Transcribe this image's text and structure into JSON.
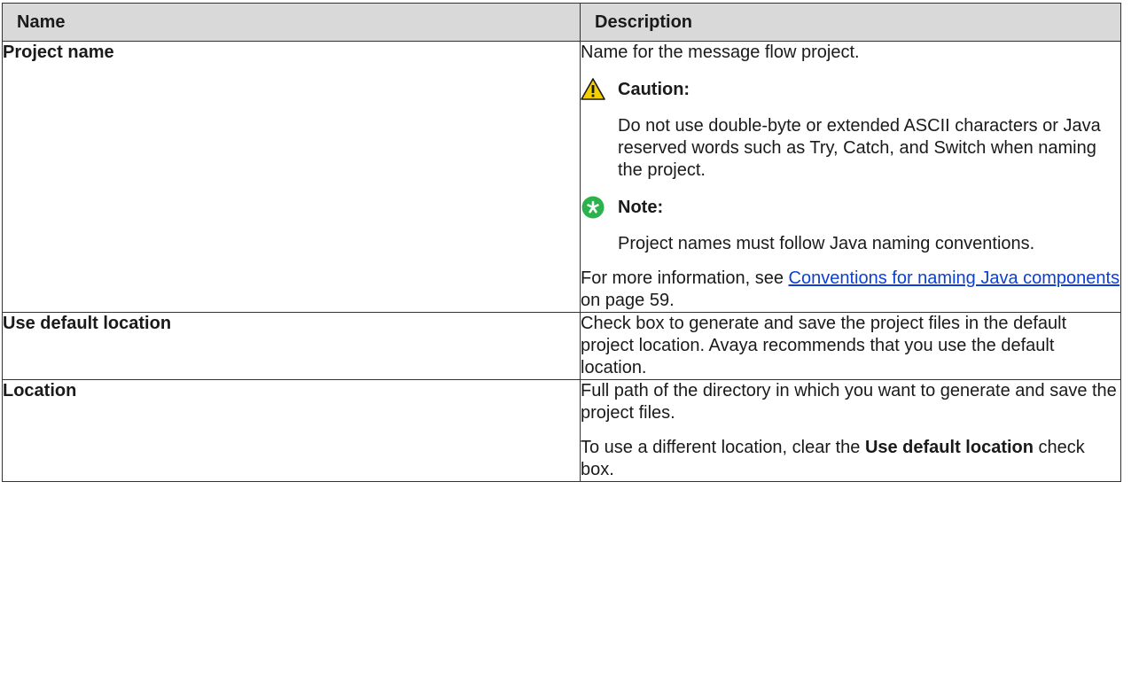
{
  "table": {
    "headers": {
      "name": "Name",
      "description": "Description"
    },
    "rows": {
      "project_name": {
        "name": "Project name",
        "p1": "Name for the message flow project.",
        "caution_label": "Caution:",
        "caution_text": "Do not use double-byte or extended ASCII characters or Java reserved words such as Try, Catch, and Switch when naming the project.",
        "note_label": "Note:",
        "note_text": "Project names must follow Java naming conventions.",
        "more_info_prefix": "For more information, see ",
        "more_info_link": "Conventions for naming Java components",
        "more_info_suffix": " on page 59."
      },
      "use_default_location": {
        "name": "Use default location",
        "desc": "Check box to generate and save the project files in the default project location. Avaya recommends that you use the default location."
      },
      "location": {
        "name": "Location",
        "p1": "Full path of the directory in which you want to generate and save the project files.",
        "p2_prefix": "To use a different location, clear the ",
        "p2_bold": "Use default location",
        "p2_suffix": " check box."
      }
    }
  },
  "icons": {
    "caution": "warning-triangle-icon",
    "note": "note-asterisk-icon"
  },
  "colors": {
    "header_bg": "#d9d9d9",
    "link": "#0b3fd6",
    "caution_yellow": "#f5d000",
    "note_green": "#2bb24c"
  }
}
